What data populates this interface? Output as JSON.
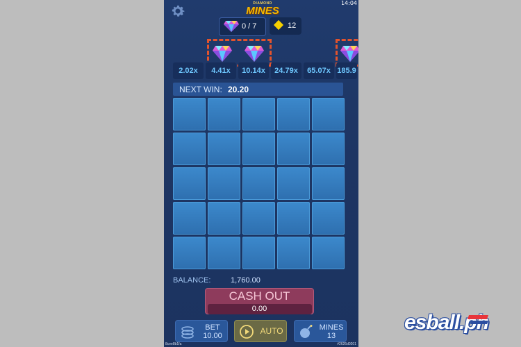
{
  "status_bar": {
    "time": "14:04"
  },
  "header": {
    "logo_sub": "DIAMOND",
    "logo_main": "MINES",
    "diamond_counter": "0 / 7",
    "gems_value": "12"
  },
  "multipliers": [
    "2.02x",
    "4.41x",
    "10.14x",
    "24.79x",
    "65.07x",
    "185.9"
  ],
  "next_win": {
    "label": "NEXT WIN:",
    "value": "20.20"
  },
  "balance": {
    "label": "BALANCE:",
    "value": "1,760.00"
  },
  "cashout": {
    "label": "CASH OUT",
    "amount": "0.00"
  },
  "controls": {
    "bet_label": "BET",
    "bet_value": "10.00",
    "auto_label": "AUTO",
    "mines_label": "MINES",
    "mines_value": "13"
  },
  "footer": {
    "left_id": "8cee8b1fa",
    "right_id": "#2626d0201"
  },
  "watermark": {
    "text": "esball.ph"
  },
  "colors": {
    "background": "#1d3563",
    "tile": "#3a86c9",
    "multiplier_text": "#6fc8ff",
    "cashout": "#8e3b5c",
    "highlight_dash": "#e2532d"
  },
  "icons": {
    "settings": "gear-icon",
    "diamond": "diamond-icon",
    "gem": "yellow-gem-icon",
    "bet": "coins-icon",
    "auto": "play-circle-icon",
    "mines": "bomb-icon"
  }
}
